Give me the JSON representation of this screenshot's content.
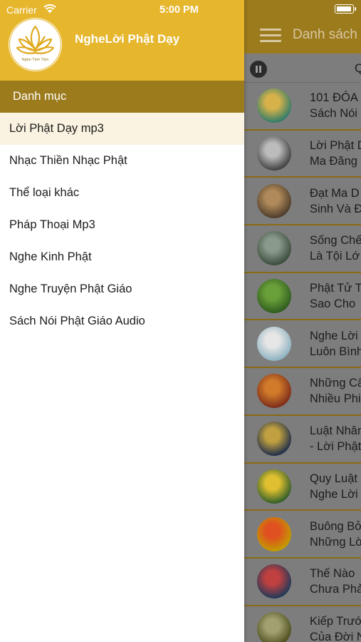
{
  "status_bar": {
    "carrier": "Carrier",
    "time": "5:00 PM"
  },
  "drawer": {
    "app_title": "NgheLời Phật Dạy",
    "logo_text": "Nghe Tịnh Tâm",
    "category_header": "Danh mục",
    "items": [
      {
        "label": "Lời Phật Dạy mp3",
        "selected": true
      },
      {
        "label": "Nhạc Thiền Nhạc Phật",
        "selected": false
      },
      {
        "label": "Thể loại khác",
        "selected": false
      },
      {
        "label": "Pháp Thoại Mp3",
        "selected": false
      },
      {
        "label": "Nghe Kinh Phật",
        "selected": false
      },
      {
        "label": "Nghe Truyện Phật Giáo",
        "selected": false
      },
      {
        "label": "Sách Nói Phật Giáo Audio",
        "selected": false
      }
    ]
  },
  "main": {
    "title": "Danh sách",
    "player_text": "Q",
    "tracks": [
      {
        "title": "101 ĐÓA\nSách Nói",
        "thumb_icon": "lotus-art-thumbnail",
        "thumb_colors": [
          "#2a7a6a",
          "#d7b24a"
        ]
      },
      {
        "title": "Lời Phật D\nMa Đăng",
        "thumb_icon": "stone-buddha-thumbnail",
        "thumb_colors": [
          "#3c3c3c",
          "#bcbcbc"
        ]
      },
      {
        "title": "Đạt Ma D\nSinh Và Đ",
        "thumb_icon": "bodhidharma-thumbnail",
        "thumb_colors": [
          "#4a3a2a",
          "#b08a5a"
        ]
      },
      {
        "title": "Sống Chế\nLà Tội Lớ",
        "thumb_icon": "buddha-statue-thumbnail",
        "thumb_colors": [
          "#3a4a3a",
          "#8a9a8a"
        ]
      },
      {
        "title": "Phật Tử T\nSao Cho",
        "thumb_icon": "green-buddha-thumbnail",
        "thumb_colors": [
          "#2e5a1e",
          "#6aa03a"
        ]
      },
      {
        "title": "Nghe Lời\nLuôn Bình",
        "thumb_icon": "blue-landscape-thumbnail",
        "thumb_colors": [
          "#8ab0c0",
          "#e6e6e6"
        ]
      },
      {
        "title": "Những Câ\nNhiều Phi",
        "thumb_icon": "red-buddha-thumbnail",
        "thumb_colors": [
          "#7a2a1a",
          "#d07a2a"
        ]
      },
      {
        "title": "Luật Nhân\n- Lời Phật",
        "thumb_icon": "night-text-thumbnail",
        "thumb_colors": [
          "#1a2a4a",
          "#c0a040"
        ]
      },
      {
        "title": "Quy Luật\nNghe Lời",
        "thumb_icon": "quy-luat-thumbnail",
        "thumb_colors": [
          "#2a5a2a",
          "#e0c030"
        ]
      },
      {
        "title": "Buông Bở\nNhững Lờ",
        "thumb_icon": "buong-bo-thumbnail",
        "thumb_colors": [
          "#c0a000",
          "#e05020"
        ]
      },
      {
        "title": "Thế Nào\nChưa Phả",
        "thumb_icon": "mountain-thumbnail",
        "thumb_colors": [
          "#1a3a5a",
          "#c04040"
        ]
      },
      {
        "title": "Kiếp Trướ\nCủa Đời N",
        "thumb_icon": "temple-thumbnail",
        "thumb_colors": [
          "#4a4a1a",
          "#a0a070"
        ]
      }
    ]
  },
  "colors": {
    "drawer_header": "#e6b62d",
    "category_header": "#9c7b1d",
    "selected_row": "#faf3e1",
    "main_header": "#9c7b1d",
    "main_overlay": "#7d7d7d"
  }
}
